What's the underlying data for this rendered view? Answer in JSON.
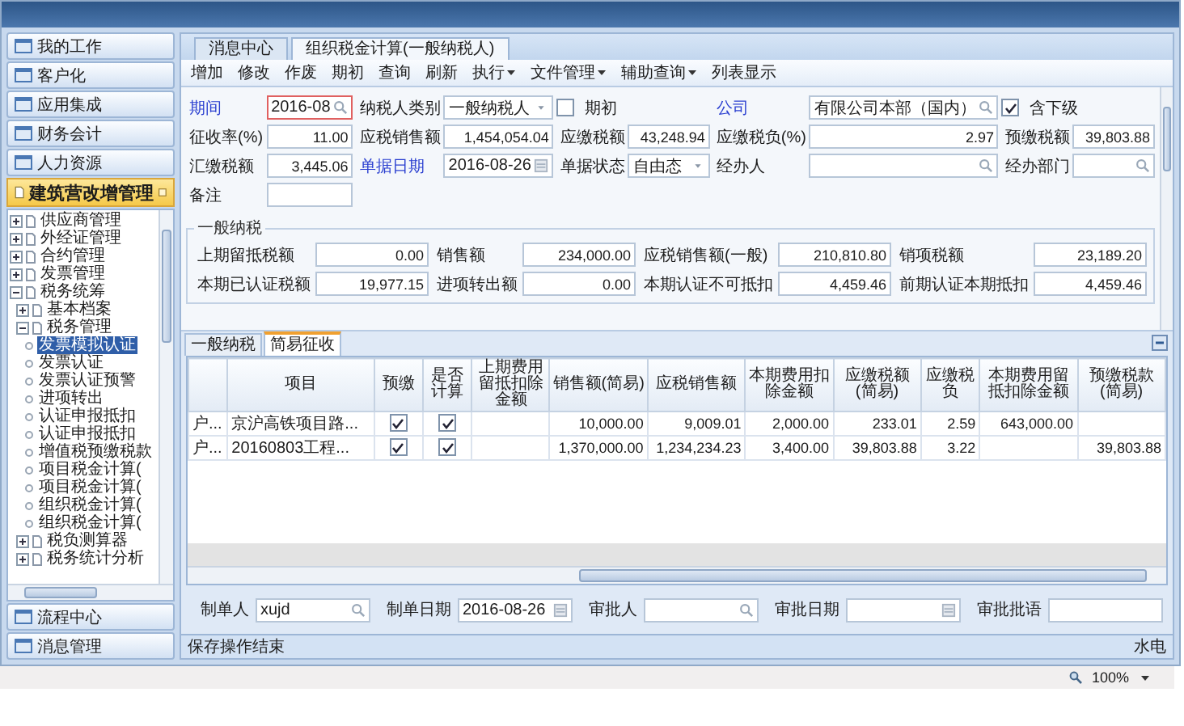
{
  "sidebar": {
    "nav_top": [
      {
        "label": "我的工作"
      },
      {
        "label": "客户化"
      },
      {
        "label": "应用集成"
      },
      {
        "label": "财务会计"
      },
      {
        "label": "人力资源"
      }
    ],
    "module": {
      "title": "建筑营改增管理"
    },
    "tree": [
      {
        "label": "供应商管理",
        "expanded": false,
        "selected": false
      },
      {
        "label": "外经证管理",
        "expanded": false,
        "selected": false
      },
      {
        "label": "合约管理",
        "expanded": false,
        "selected": false
      },
      {
        "label": "发票管理",
        "expanded": false,
        "selected": false
      },
      {
        "label": "税务统筹",
        "expanded": true,
        "selected": false,
        "children": [
          {
            "label": "基本档案",
            "expanded": false,
            "selected": false
          },
          {
            "label": "税务管理",
            "expanded": true,
            "selected": false,
            "children": [
              {
                "label": "发票模拟认证",
                "selected": true
              },
              {
                "label": "发票认证",
                "selected": false
              },
              {
                "label": "发票认证预警",
                "selected": false
              },
              {
                "label": "进项转出",
                "selected": false
              },
              {
                "label": "认证申报抵扣",
                "selected": false
              },
              {
                "label": "认证申报抵扣",
                "selected": false
              },
              {
                "label": "增值税预缴税款",
                "selected": false
              },
              {
                "label": "项目税金计算(",
                "selected": false
              },
              {
                "label": "项目税金计算(",
                "selected": false
              },
              {
                "label": "组织税金计算(",
                "selected": false
              },
              {
                "label": "组织税金计算(",
                "selected": false
              }
            ]
          },
          {
            "label": "税负测算器",
            "expanded": false,
            "selected": false
          },
          {
            "label": "税务统计分析",
            "expanded": false,
            "selected": false
          }
        ]
      }
    ],
    "nav_bottom": [
      {
        "label": "流程中心"
      },
      {
        "label": "消息管理"
      }
    ]
  },
  "tabs": [
    {
      "label": "消息中心",
      "selected": false
    },
    {
      "label": "组织税金计算(一般纳税人)",
      "selected": true
    }
  ],
  "toolbar": [
    {
      "label": "增加",
      "dropdown": false
    },
    {
      "label": "修改",
      "dropdown": false
    },
    {
      "label": "作废",
      "dropdown": false
    },
    {
      "label": "期初",
      "dropdown": false
    },
    {
      "label": "查询",
      "dropdown": false
    },
    {
      "label": "刷新",
      "dropdown": false
    },
    {
      "label": "执行",
      "dropdown": true
    },
    {
      "label": "文件管理",
      "dropdown": true
    },
    {
      "label": "辅助查询",
      "dropdown": true
    },
    {
      "label": "列表显示",
      "dropdown": false
    }
  ],
  "form": {
    "rows": [
      [
        {
          "kind": "search",
          "label": "期间",
          "value": "2016-08",
          "emphasized": true,
          "focused": true
        },
        {
          "kind": "select",
          "label": "纳税人类别",
          "value": "一般纳税人",
          "emphasized": false,
          "focused": false
        },
        {
          "kind": "checkbox",
          "label": "期初",
          "checked": false
        },
        {
          "kind": "search",
          "label": "公司",
          "value": "有限公司本部（国内）",
          "emphasized": true,
          "focused": false
        },
        {
          "kind": "checkbox",
          "label": "含下级",
          "checked": true
        }
      ],
      [
        {
          "kind": "number",
          "label": "征收率(%)",
          "value": "11.00",
          "emphasized": false,
          "focused": false
        },
        {
          "kind": "number",
          "label": "应税销售额",
          "value": "1,454,054.04",
          "emphasized": false,
          "focused": false
        },
        {
          "kind": "number",
          "label": "应缴税额",
          "value": "43,248.94",
          "emphasized": false,
          "focused": false
        },
        {
          "kind": "number",
          "label": "应缴税负(%)",
          "value": "2.97",
          "emphasized": false,
          "focused": false
        },
        {
          "kind": "number",
          "label": "预缴税额",
          "value": "39,803.88",
          "emphasized": false,
          "focused": false
        }
      ],
      [
        {
          "kind": "number",
          "label": "汇缴税额",
          "value": "3,445.06",
          "emphasized": false,
          "focused": false
        },
        {
          "kind": "date",
          "label": "单据日期",
          "value": "2016-08-26",
          "emphasized": true,
          "focused": false
        },
        {
          "kind": "select",
          "label": "单据状态",
          "value": "自由态",
          "emphasized": false,
          "focused": false
        },
        {
          "kind": "search",
          "label": "经办人",
          "emphasized": false,
          "focused": false
        },
        {
          "kind": "search",
          "label": "经办部门",
          "emphasized": false,
          "focused": false
        }
      ],
      [
        {
          "kind": "text",
          "label": "备注",
          "emphasized": false,
          "focused": false
        }
      ]
    ]
  },
  "general_tax": {
    "title": "一般纳税",
    "rows": [
      [
        {
          "label": "上期留抵税额",
          "value": "0.00"
        },
        {
          "label": "销售额",
          "value": "234,000.00"
        },
        {
          "label": "应税销售额(一般)",
          "value": "210,810.80"
        },
        {
          "label": "销项税额",
          "value": "23,189.20"
        }
      ],
      [
        {
          "label": "本期已认证税额",
          "value": "19,977.15"
        },
        {
          "label": "进项转出额",
          "value": "0.00"
        },
        {
          "label": "本期认证不可抵扣",
          "value": "4,459.46"
        },
        {
          "label": "前期认证本期抵扣",
          "value": "4,459.46"
        }
      ]
    ]
  },
  "sub_tabs": [
    {
      "label": "一般纳税",
      "selected": false
    },
    {
      "label": "简易征收",
      "selected": true
    }
  ],
  "table": {
    "columns": [
      "项目",
      "预缴",
      "是否计算",
      "上期费用留抵扣除金额",
      "销售额(简易)",
      "应税销售额",
      "本期费用扣除金额",
      "应缴税额(简易)",
      "应缴税负",
      "本期费用留抵扣除金额",
      "预缴税款(简易)"
    ],
    "rows": [
      {
        "marker": "户...",
        "project": "京沪高铁项目路...",
        "prepaid": true,
        "calculate": true,
        "sales": "10,000.00",
        "taxable_sales": "9,009.01",
        "current_deduction": "2,000.00",
        "tax_payable": "233.01",
        "tax_burden": "2.59",
        "current_carryover": "643,000.00"
      },
      {
        "marker": "户...",
        "project": "20160803工程...",
        "prepaid": true,
        "calculate": true,
        "sales": "1,370,000.00",
        "taxable_sales": "1,234,234.23",
        "current_deduction": "3,400.00",
        "tax_payable": "39,803.88",
        "tax_burden": "3.22",
        "prepaid_tax": "39,803.88"
      }
    ]
  },
  "footer": {
    "fields": [
      {
        "kind": "search",
        "label": "制单人",
        "value": "xujd"
      },
      {
        "kind": "date",
        "label": "制单日期",
        "value": "2016-08-26"
      },
      {
        "kind": "search",
        "label": "审批人"
      },
      {
        "kind": "date",
        "label": "审批日期"
      },
      {
        "kind": "text",
        "label": "审批批语"
      }
    ]
  },
  "status_bar": {
    "message": "保存操作结束",
    "right": "水电"
  },
  "browser_status": {
    "zoom": "100%"
  }
}
